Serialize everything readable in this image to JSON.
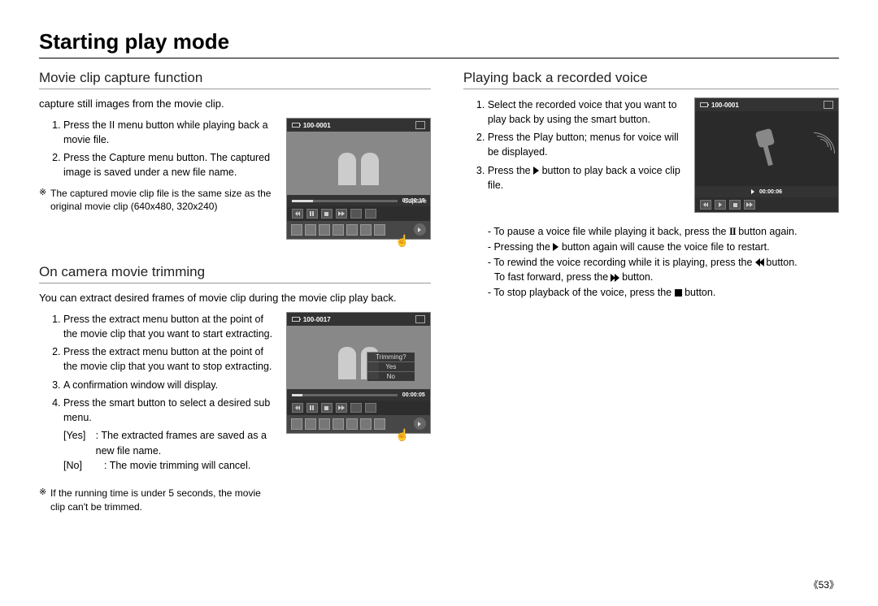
{
  "page_title": "Starting play mode",
  "page_number": "53",
  "left": {
    "section1": {
      "heading": "Movie clip capture function",
      "intro": "capture still images from the movie clip.",
      "steps": [
        "Press the II menu button while playing back a movie file.",
        "Press the Capture menu button. The captured image is saved under a new file name."
      ],
      "note": "The captured movie clip file is the same size as the original movie clip (640x480, 320x240)",
      "screenshot": {
        "file_label": "100-0001",
        "time": "00:00:15",
        "overlay_label": "Capture"
      }
    },
    "section2": {
      "heading": "On camera movie trimming",
      "intro": "You can extract desired frames of movie clip during the movie clip play back.",
      "steps": [
        "Press the extract menu button at the point of the movie clip that you want to start extracting.",
        "Press the extract menu button at the point of the movie clip that you want to stop extracting.",
        "A confirmation window will display.",
        "Press the smart button to select a desired sub menu."
      ],
      "yesno": [
        {
          "label": "[Yes]",
          "text": ": The extracted frames are saved as a new file name."
        },
        {
          "label": "[No]",
          "text": ": The movie trimming will cancel."
        }
      ],
      "note": "If the running time is under 5 seconds, the movie clip can't be trimmed.",
      "screenshot": {
        "file_label": "100-0017",
        "time": "00:00:05",
        "dialog_title": "Trimming?",
        "opt_yes": "Yes",
        "opt_no": "No"
      }
    }
  },
  "right": {
    "heading": "Playing back a recorded voice",
    "steps": [
      "Select the recorded voice that you want to play back by using the smart button.",
      "Press the Play button; menus for voice will be displayed.",
      "Press the ▶ button to play back a voice clip file."
    ],
    "sub": {
      "pause_pre": "- To pause a voice file while playing it back, press the ",
      "pause_btn": "II",
      "pause_post": " button again.",
      "restart_pre": "- Pressing the ",
      "restart_post": " button again will cause the voice file to restart.",
      "rewind_pre": "- To rewind the voice recording while it is playing, press the ",
      "rewind_post": " button.",
      "ff_pre": "  To fast forward, press the ",
      "ff_post": " button.",
      "stop_pre": "- To stop playback of the voice, press the ",
      "stop_post": " button."
    },
    "screenshot": {
      "file_label": "100-0001",
      "time": "00:00:06"
    }
  }
}
